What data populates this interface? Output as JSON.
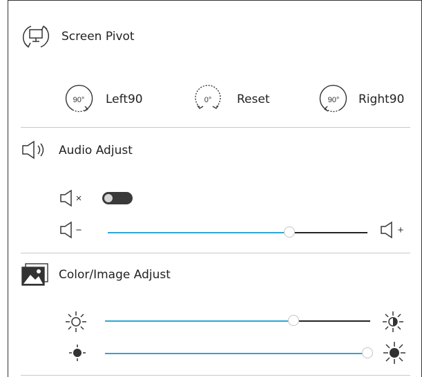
{
  "screen_pivot": {
    "title": "Screen Pivot",
    "buttons": [
      {
        "label": "Left90",
        "icon_text": "90°"
      },
      {
        "label": "Reset",
        "icon_text": "0°"
      },
      {
        "label": "Right90",
        "icon_text": "90°"
      }
    ]
  },
  "audio_adjust": {
    "title": "Audio Adjust",
    "mute_toggle_on": false,
    "volume_percent": 70,
    "volume_down_symbol": "−",
    "volume_up_symbol": "+",
    "mute_symbol": "×"
  },
  "color_image_adjust": {
    "title": "Color/Image Adjust",
    "brightness_percent": 71,
    "contrast_percent": 99
  },
  "colors": {
    "accent": "#2aa6d6",
    "track": "#222222",
    "divider": "#c8c8c8",
    "toggle_bg": "#3a3a3a"
  }
}
